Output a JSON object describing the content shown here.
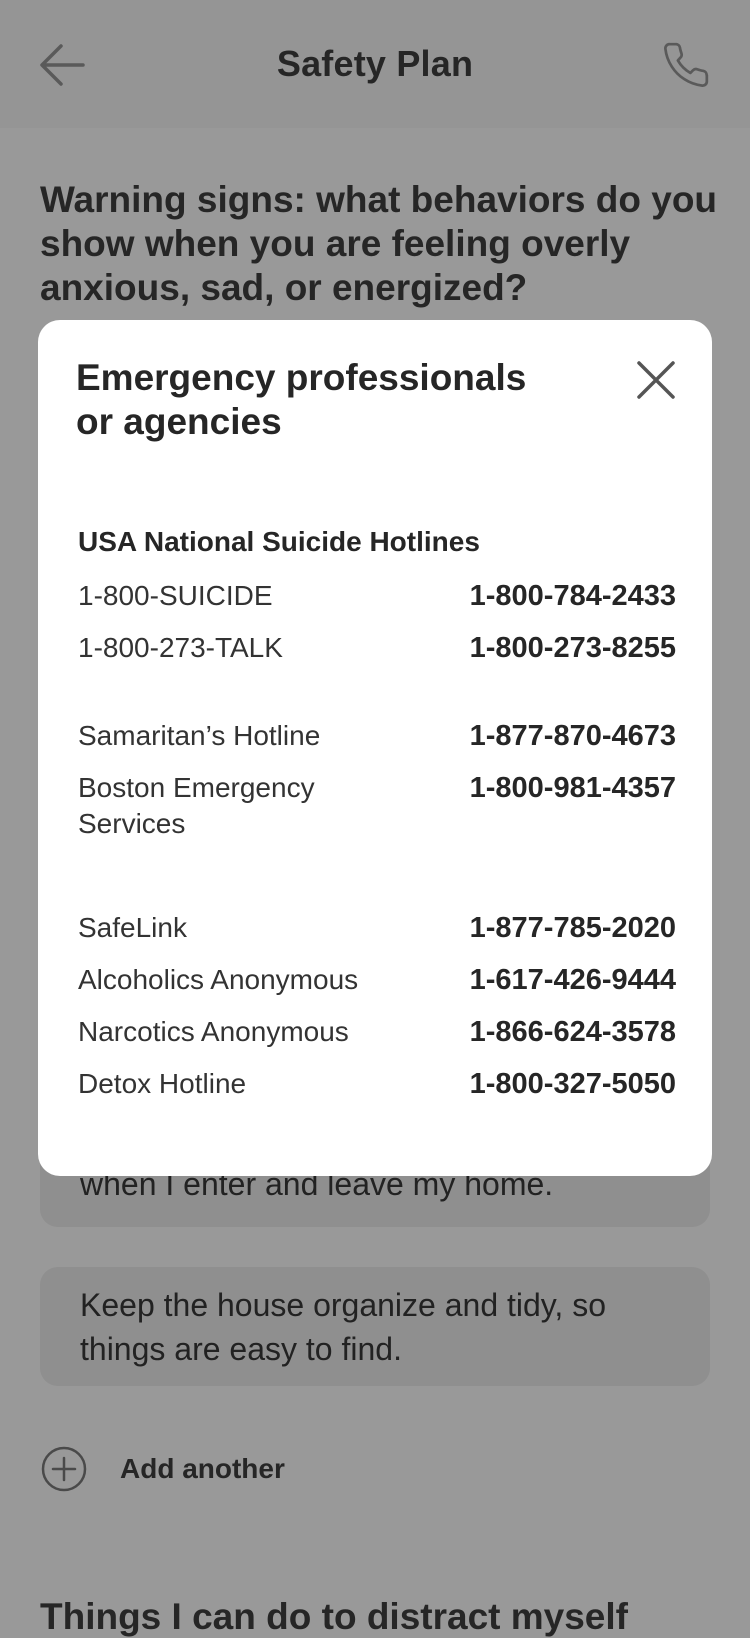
{
  "header": {
    "title": "Safety Plan",
    "back_icon": "arrow-left-icon",
    "call_icon": "phone-icon"
  },
  "question": "Warning signs: what behaviors do you show when you are feeling overly anxious, sad, or energized?",
  "cards": [
    {
      "text": "when I enter and leave my home."
    },
    {
      "text": "Keep the house organize and tidy, so things are easy to find."
    }
  ],
  "add_another": {
    "label": "Add another",
    "icon": "plus-circle-icon"
  },
  "next_section_heading": "Things I can do to distract myself",
  "modal": {
    "title": "Emergency professionals or agencies",
    "close_icon": "close-icon",
    "section_heading": "USA National Suicide Hotlines",
    "groups": [
      [
        {
          "name": "1-800-SUICIDE",
          "number": "1-800-784-2433"
        },
        {
          "name": "1-800-273-TALK",
          "number": "1-800-273-8255"
        }
      ],
      [
        {
          "name": "Samaritan’s Hotline",
          "number": "1-877-870-4673"
        },
        {
          "name": "Boston Emergency Services",
          "number": "1-800-981-4357"
        }
      ],
      [
        {
          "name": "SafeLink",
          "number": "1-877-785-2020"
        },
        {
          "name": "Alcoholics Anonymous",
          "number": "1-617-426-9444"
        },
        {
          "name": "Narcotics Anonymous",
          "number": "1-866-624-3578"
        },
        {
          "name": "Detox Hotline",
          "number": "1-800-327-5050"
        }
      ]
    ]
  },
  "colors": {
    "overlay_background": "#999999",
    "header_background": "#959595",
    "card_background": "#8f8f8f",
    "modal_background": "#ffffff",
    "text": "#262626"
  }
}
